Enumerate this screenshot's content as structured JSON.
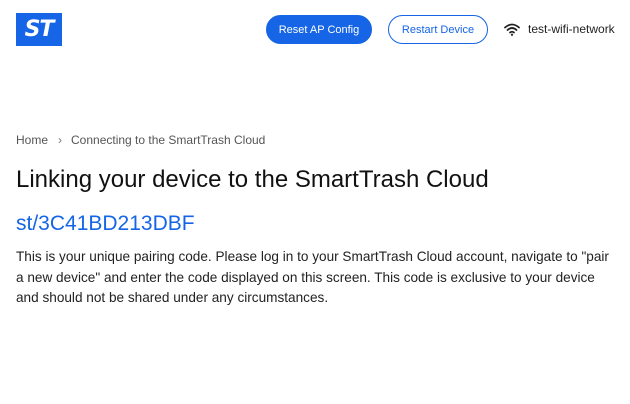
{
  "header": {
    "logo_text": "ST",
    "reset_button_label": "Reset AP Config",
    "restart_button_label": "Restart Device",
    "network_icon": "wifi-icon",
    "network_name": "test-wifi-network"
  },
  "breadcrumb": {
    "home": "Home",
    "separator": "›",
    "current": "Connecting to the SmartTrash Cloud"
  },
  "main": {
    "title": "Linking your device to the SmartTrash Cloud",
    "pairing_code": "st/3C41BD213DBF",
    "description": "This is your unique pairing code. Please log in to your SmartTrash Cloud account, navigate to \"pair a new device\" and enter the code displayed on this screen. This code is exclusive to your device and should not be shared under any circumstances."
  },
  "colors": {
    "accent": "#1565e6",
    "text": "#222222"
  }
}
